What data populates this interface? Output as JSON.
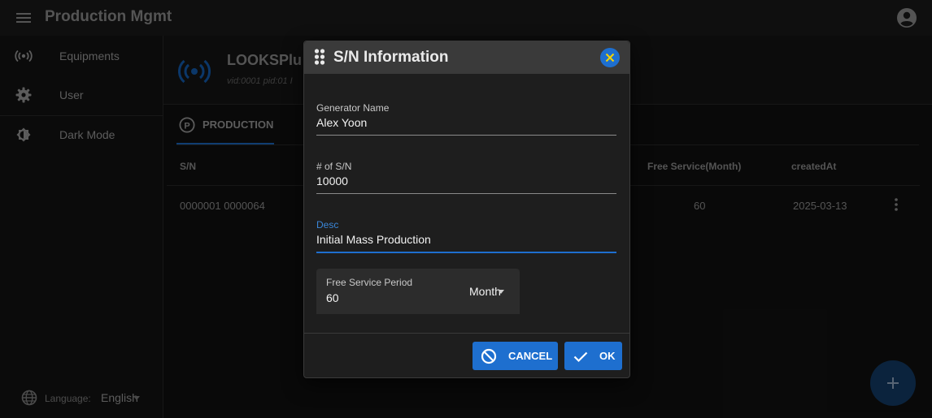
{
  "app": {
    "title": "Production Mgmt"
  },
  "drawer": {
    "items": [
      {
        "label": "Equipments",
        "icon": "broadcast-icon"
      },
      {
        "label": "User",
        "icon": "gear-icon"
      },
      {
        "label": "Dark Mode",
        "icon": "brightness-icon"
      }
    ],
    "language_label": "Language:",
    "language_value": "English"
  },
  "device": {
    "name": "LOOKSPlu",
    "sub": "vid:0001 pid:01 I"
  },
  "tabs": [
    {
      "label": "PRODUCTION",
      "icon": "parking-p-icon"
    }
  ],
  "table": {
    "columns": [
      "S/N",
      "Free Service(Month)",
      "createdAt"
    ],
    "rows": [
      {
        "sn": "0000001 0000064",
        "free_service": "60",
        "created_at": "2025-03-13"
      }
    ]
  },
  "dialog": {
    "title": "S/N Information",
    "fields": {
      "generator_name": {
        "label": "Generator Name",
        "value": "Alex Yoon"
      },
      "sn_count": {
        "label": "# of S/N",
        "value": "10000"
      },
      "desc": {
        "label": "Desc",
        "value": "Initial Mass Production"
      },
      "free_service_period": {
        "label": "Free Service Period",
        "value": "60",
        "unit": "Month"
      }
    },
    "buttons": {
      "cancel": "CANCEL",
      "ok": "OK"
    }
  },
  "colors": {
    "accent": "#1e6fcf",
    "fab": "#14406f",
    "surface": "#1e1e1e"
  }
}
